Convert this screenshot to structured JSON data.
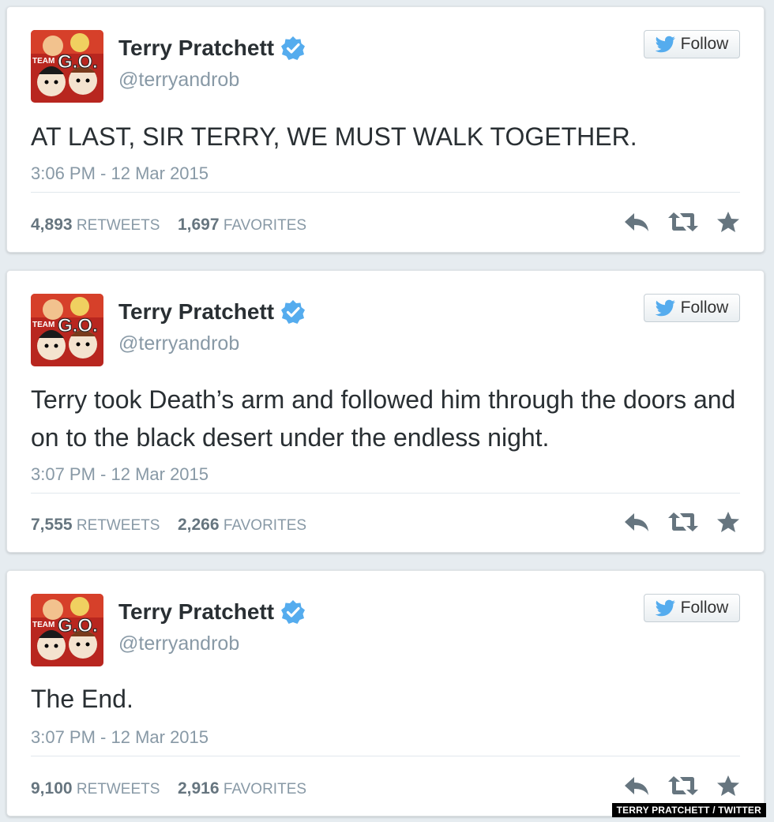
{
  "tweets": [
    {
      "name": "Terry Pratchett",
      "handle": "@terryandrob",
      "follow_label": "Follow",
      "avatar_text": "TEAM G.O.",
      "text": "AT LAST, SIR TERRY, WE MUST WALK TOGETHER.",
      "time": "3:06 PM - 12 Mar 2015",
      "retweets": "4,893",
      "retweets_label": "RETWEETS",
      "favorites": "1,697",
      "favorites_label": "FAVORITES"
    },
    {
      "name": "Terry Pratchett",
      "handle": "@terryandrob",
      "follow_label": "Follow",
      "avatar_text": "TEAM G.O.",
      "text": "Terry took Death’s arm and followed him through the doors and on to the black desert under the endless night.",
      "time": "3:07 PM - 12 Mar 2015",
      "retweets": "7,555",
      "retweets_label": "RETWEETS",
      "favorites": "2,266",
      "favorites_label": "FAVORITES"
    },
    {
      "name": "Terry Pratchett",
      "handle": "@terryandrob",
      "follow_label": "Follow",
      "avatar_text": "TEAM G.O.",
      "text": "The End.",
      "time": "3:07 PM - 12 Mar 2015",
      "retweets": "9,100",
      "retweets_label": "RETWEETS",
      "favorites": "2,916",
      "favorites_label": "FAVORITES"
    }
  ],
  "credit": "TERRY PRATCHETT / TWITTER",
  "icons": {
    "verified": "verified-badge-icon",
    "bird": "twitter-bird-icon",
    "reply": "reply-icon",
    "retweet": "retweet-icon",
    "favorite": "star-icon"
  },
  "colors": {
    "verified": "#55acee",
    "bird": "#55acee",
    "action_icon": "#66757f",
    "name": "#292f33",
    "muted": "#8899a6"
  }
}
